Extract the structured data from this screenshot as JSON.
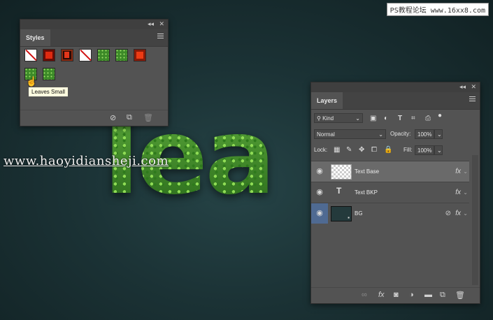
{
  "canvas": {
    "leaf_text": "lea"
  },
  "watermarks": {
    "top_right": "PS教程论坛 www.16xx8.com",
    "middle": "www.haoyidiansheji.com"
  },
  "styles_panel": {
    "tab": "Styles",
    "tooltip": "Leaves Small",
    "footer_icons": [
      "no-icon",
      "new-style-icon",
      "trash-icon"
    ]
  },
  "layers_panel": {
    "tab": "Layers",
    "filter_kind": "Kind",
    "blend_mode": "Normal",
    "opacity_label": "Opacity:",
    "opacity_value": "100%",
    "lock_label": "Lock:",
    "fill_label": "Fill:",
    "fill_value": "100%",
    "layers": [
      {
        "name": "Text Base",
        "fx": "fx"
      },
      {
        "name": "Text BKP",
        "fx": "fx"
      },
      {
        "name": "BG",
        "fx": "fx"
      }
    ],
    "footer_icons": [
      "link-icon",
      "fx-icon",
      "mask-icon",
      "adjustment-icon",
      "folder-icon",
      "new-layer-icon",
      "trash-icon"
    ]
  }
}
